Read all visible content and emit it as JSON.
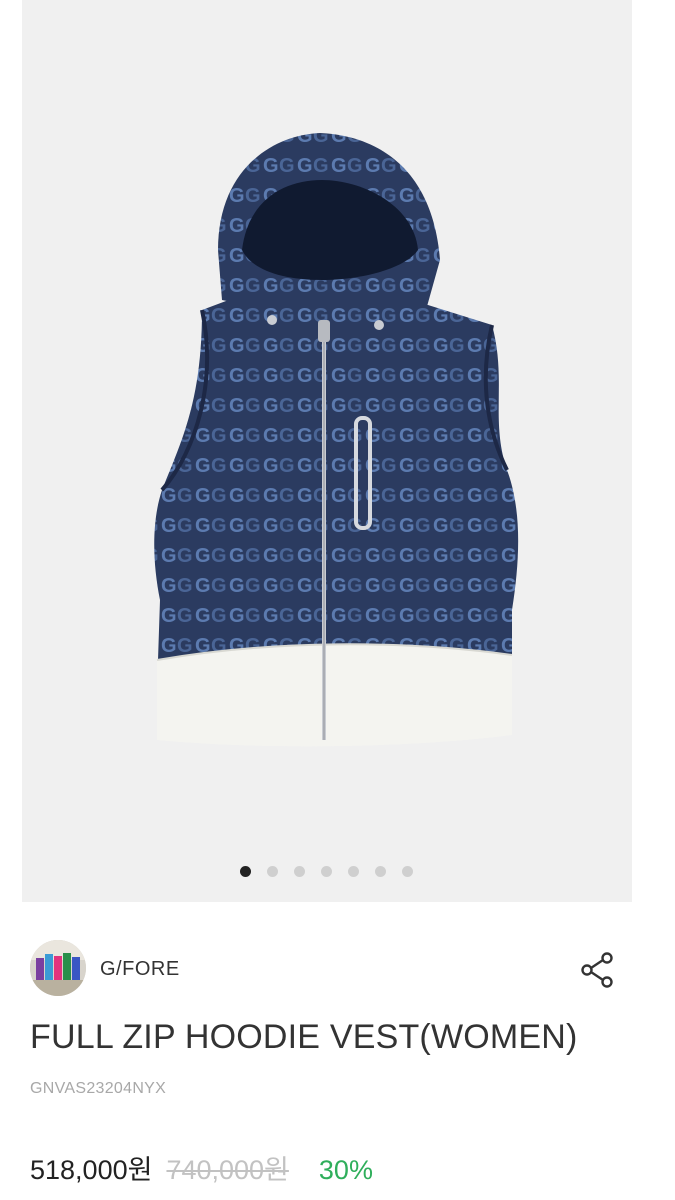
{
  "product": {
    "image_alt": "G/FORE full zip hoodie vest with navy G monogram pattern and white hem",
    "gallery": {
      "total": 7,
      "active": 0
    },
    "brand": {
      "name": "G/FORE",
      "avatar_icon": "brand-avatar-photo"
    },
    "share_icon": "share-icon",
    "title": "FULL ZIP HOODIE VEST(WOMEN)",
    "sku": "GNVAS23204NYX",
    "price": "518,000원",
    "original_price": "740,000원",
    "discount": "30%"
  },
  "colors": {
    "gallery_bg": "#f0f0f0",
    "navy": "#28375a",
    "accent_green": "#2fae5b"
  }
}
